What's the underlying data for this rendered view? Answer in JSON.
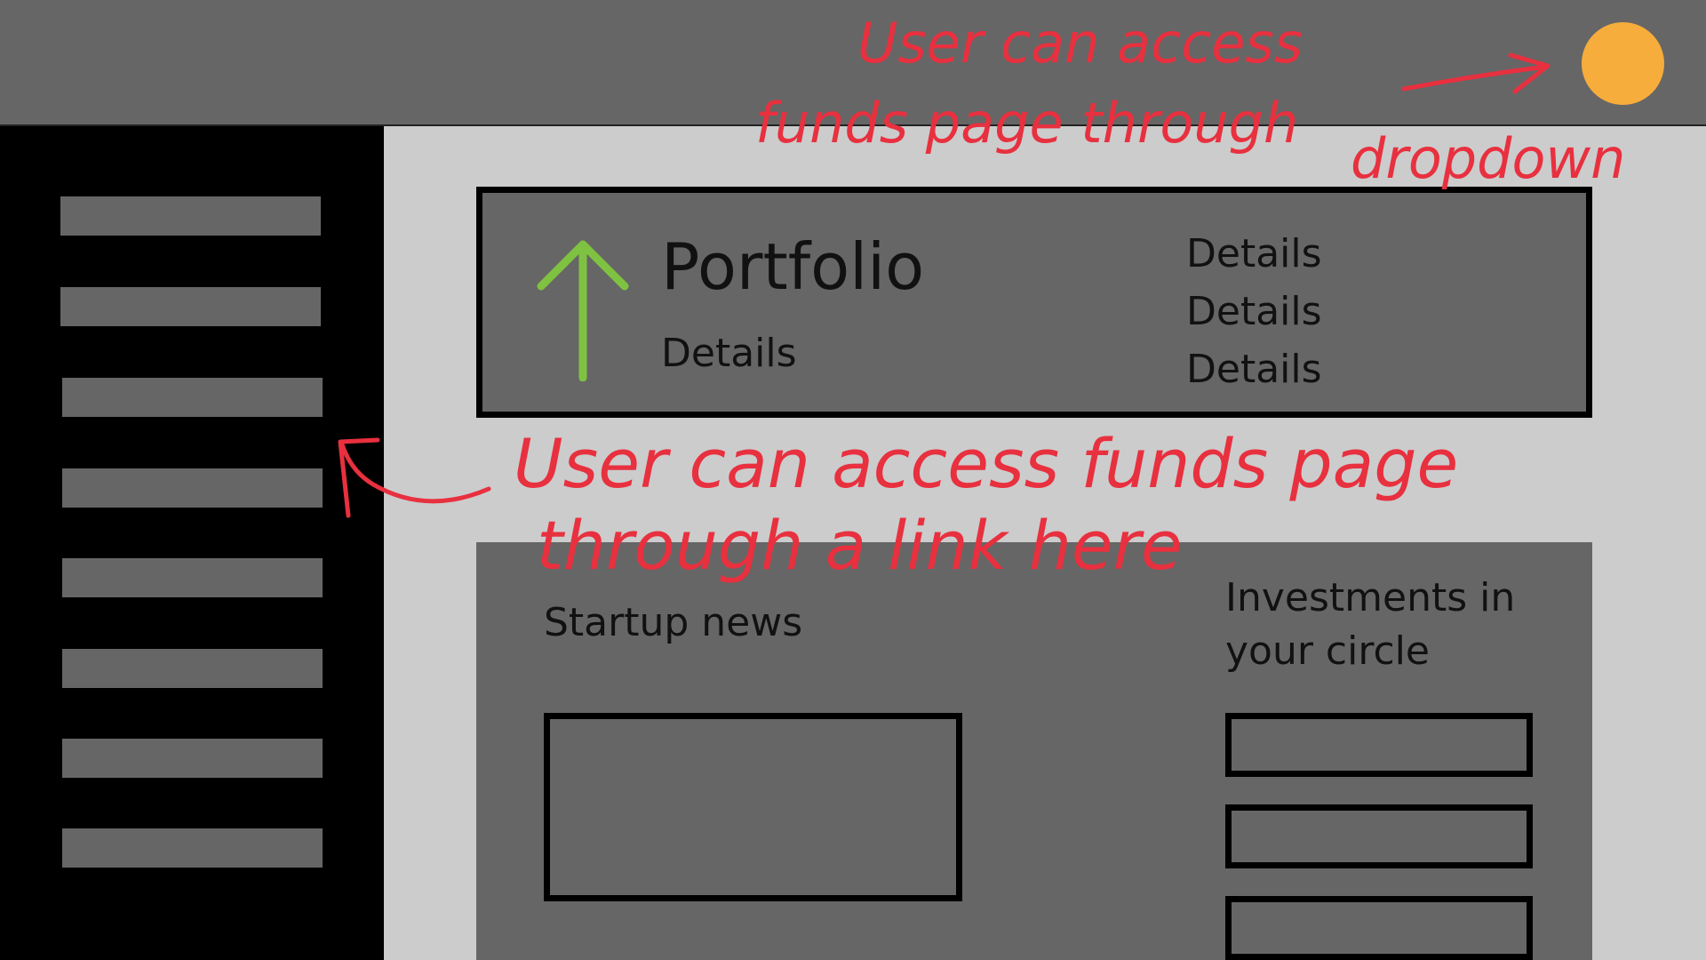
{
  "portfolio": {
    "title": "Portfolio",
    "details": "Details",
    "side_details": [
      "Details",
      "Details",
      "Details"
    ]
  },
  "news": {
    "title": "Startup news"
  },
  "circle": {
    "title": "Investments in your circle"
  },
  "annotations": {
    "top_line1": "User can access",
    "top_line2": "funds page through",
    "top_line3": "dropdown",
    "mid_line1": "User can access funds page",
    "mid_line2": "through a link here"
  },
  "colors": {
    "topbar": "#666666",
    "sidebar": "#000000",
    "card": "#666666",
    "background": "#cccccc",
    "avatar": "#f7ad3b",
    "arrow": "#7fc241",
    "annotation": "#e8303f"
  },
  "icons": {
    "avatar": "user-avatar-circle",
    "trend": "arrow-up-icon"
  }
}
